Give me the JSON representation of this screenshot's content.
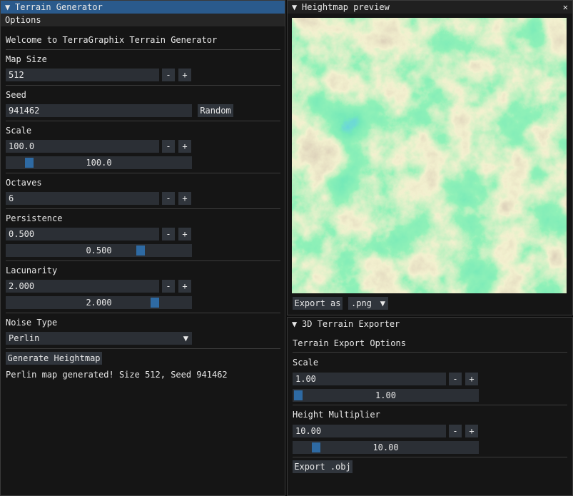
{
  "left": {
    "title": "Terrain Generator",
    "menu": {
      "options": "Options"
    },
    "welcome": "Welcome to TerraGraphix Terrain Generator",
    "map_size": {
      "label": "Map Size",
      "value": "512"
    },
    "seed": {
      "label": "Seed",
      "value": "941462",
      "random_label": "Random"
    },
    "scale": {
      "label": "Scale",
      "value": "100.0",
      "slider": "100.0",
      "slider_fraction": 0.1
    },
    "octaves": {
      "label": "Octaves",
      "value": "6"
    },
    "persistence": {
      "label": "Persistence",
      "value": "0.500",
      "slider": "0.500",
      "slider_fraction": 0.74
    },
    "lacunarity": {
      "label": "Lacunarity",
      "value": "2.000",
      "slider": "2.000",
      "slider_fraction": 0.82
    },
    "noise_type": {
      "label": "Noise Type",
      "value": "Perlin"
    },
    "generate_label": "Generate Heightmap",
    "status": "Perlin map generated! Size 512, Seed 941462"
  },
  "buttons": {
    "minus": "-",
    "plus": "+"
  },
  "icons": {
    "collapse": "▼",
    "close": "✕",
    "dropdown": "▼"
  },
  "preview": {
    "title": "Heightmap preview",
    "export_label": "Export as",
    "format": ".png"
  },
  "exporter": {
    "title": "3D Terrain Exporter",
    "heading": "Terrain Export Options",
    "scale": {
      "label": "Scale",
      "value": "1.00",
      "slider": "1.00",
      "slider_fraction": 0.0
    },
    "height": {
      "label": "Height Multiplier",
      "value": "10.00",
      "slider": "10.00",
      "slider_fraction": 0.1
    },
    "export_obj_label": "Export .obj"
  },
  "colors": {
    "accent": "#2a5a8c",
    "slider_grab": "#2e6aa3",
    "terrain": [
      "#1e4bd2",
      "#1e8ce0",
      "#2ed07a",
      "#46e07a",
      "#e6e0a0",
      "#b09a78",
      "#6b5050",
      "#e8e0e0"
    ]
  }
}
